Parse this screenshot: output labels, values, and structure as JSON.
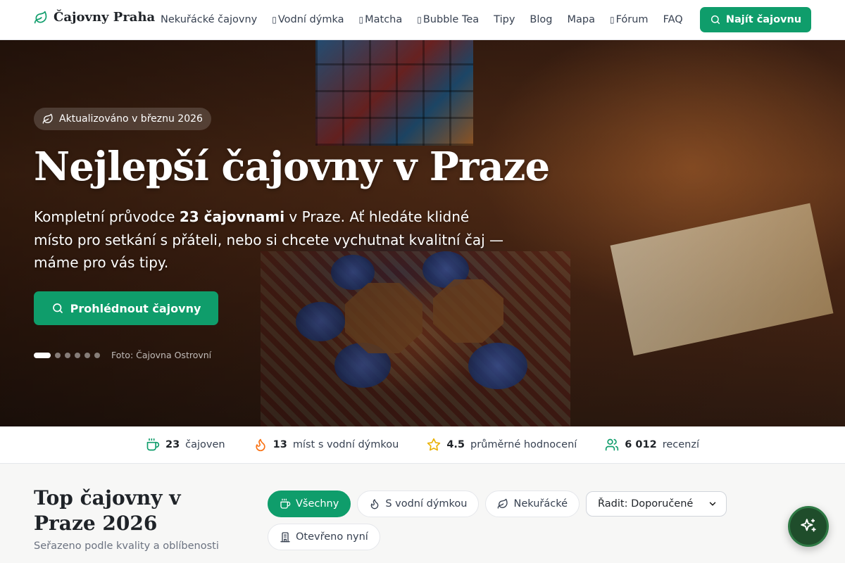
{
  "brand": {
    "name": "Čajovny Praha",
    "icon": "leaf-icon"
  },
  "nav": {
    "items": [
      {
        "label": "Nekuřácké čajovny",
        "prefix": ""
      },
      {
        "label": "Vodní dýmka",
        "prefix": "▯"
      },
      {
        "label": "Matcha",
        "prefix": "▯"
      },
      {
        "label": "Bubble Tea",
        "prefix": "▯"
      },
      {
        "label": "Tipy",
        "prefix": ""
      },
      {
        "label": "Blog",
        "prefix": ""
      },
      {
        "label": "Mapa",
        "prefix": ""
      },
      {
        "label": "Fórum",
        "prefix": "▯"
      },
      {
        "label": "FAQ",
        "prefix": ""
      }
    ],
    "cta_label": "Najít čajovnu"
  },
  "hero": {
    "badge": "Aktualizováno v březnu 2026",
    "title": "Nejlepší čajovny v Praze",
    "desc_before": "Kompletní průvodce ",
    "desc_strong": "23 čajovnami",
    "desc_after": " v Praze. Ať hledáte klidné místo pro setkání s přáteli, nebo si chcete vychutnat kvalitní čaj — máme pro vás tipy.",
    "cta_label": "Prohlédnout čajovny",
    "slides_total": 6,
    "slide_active": 1,
    "photo_credit": "Foto: Čajovna Ostrovní"
  },
  "stats": [
    {
      "icon": "cup-icon",
      "value": "23",
      "label": "čajoven"
    },
    {
      "icon": "flame-icon",
      "value": "13",
      "label": "míst s vodní dýmkou"
    },
    {
      "icon": "star-icon",
      "value": "4.5",
      "label": "průměrné hodnocení"
    },
    {
      "icon": "users-icon",
      "value": "6 012",
      "label": "recenzí"
    }
  ],
  "section": {
    "title": "Top čajovny v Praze 2026",
    "subtitle": "Seřazeno podle kvality a oblíbenosti"
  },
  "filters": {
    "all": "Všechny",
    "hookah": "S vodní dýmkou",
    "nonsmoking": "Nekuřácké",
    "sort_label": "Řadit: Doporučené",
    "open_now": "Otevřeno nyní"
  },
  "colors": {
    "accent": "#0f9d6b",
    "fab": "#1f4d2b"
  }
}
